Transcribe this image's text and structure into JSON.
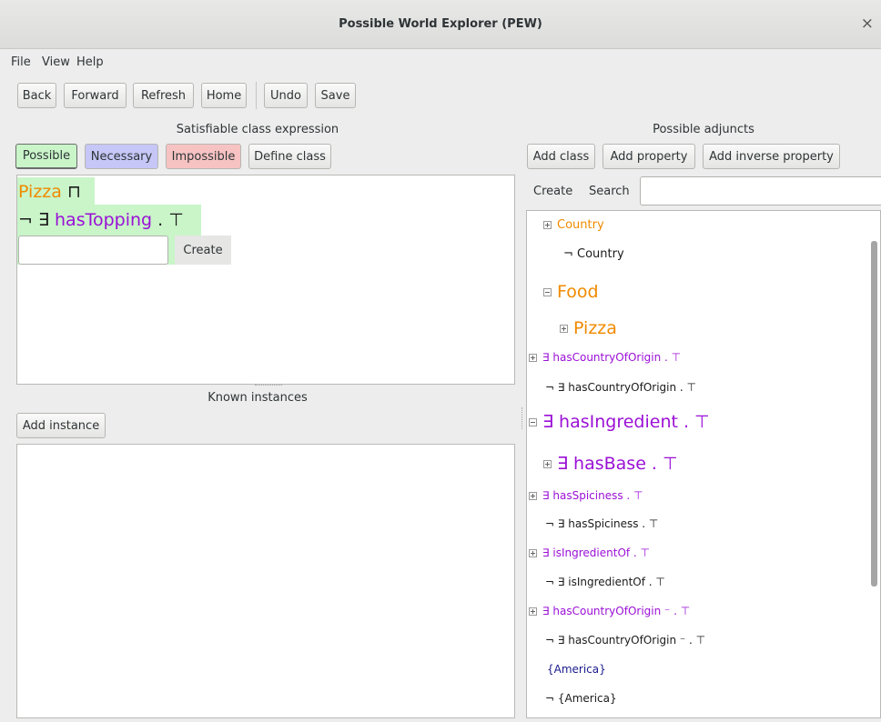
{
  "window": {
    "title": "Possible World Explorer (PEW)",
    "close_glyph": "×"
  },
  "menu": [
    "File",
    "View",
    "Help"
  ],
  "toolbar": {
    "back": "Back",
    "forward": "Forward",
    "refresh": "Refresh",
    "home": "Home",
    "undo": "Undo",
    "save": "Save"
  },
  "left": {
    "expr_title": "Satisfiable class expression",
    "modal_buttons": {
      "possible": "Possible",
      "necessary": "Necessary",
      "impossible": "Impossible",
      "define": "Define class"
    },
    "expression": {
      "line1_class": "Pizza",
      "line1_op": "⊓",
      "line2_neg": "¬ ∃",
      "line2_prop": "hasTopping",
      "line2_rest": ". ⊤"
    },
    "create_button": "Create",
    "instances_title": "Known instances",
    "add_instance": "Add instance"
  },
  "right": {
    "title": "Possible adjuncts",
    "buttons": {
      "add_class": "Add class",
      "add_property": "Add property",
      "add_inverse_property": "Add inverse property"
    },
    "create_label": "Create",
    "search_label": "Search",
    "tree": [
      {
        "text": "Country",
        "color": "orange",
        "expander": "plus"
      },
      {
        "text": "¬ Country",
        "color": "black",
        "expander": "none"
      },
      {
        "text": "Food",
        "color": "orange",
        "expander": "minus"
      },
      {
        "text": "Pizza",
        "color": "orange",
        "expander": "plus"
      },
      {
        "text": "∃ hasCountryOfOrigin . ⊤",
        "color": "purple",
        "expander": "plus"
      },
      {
        "text": "¬ ∃ hasCountryOfOrigin . ⊤",
        "color": "black",
        "expander": "none"
      },
      {
        "text": "∃ hasIngredient . ⊤",
        "color": "purple",
        "expander": "minus"
      },
      {
        "text": "∃ hasBase . ⊤",
        "color": "purple",
        "expander": "plus"
      },
      {
        "text": "∃ hasSpiciness . ⊤",
        "color": "purple",
        "expander": "plus"
      },
      {
        "text": "¬ ∃ hasSpiciness . ⊤",
        "color": "black",
        "expander": "none"
      },
      {
        "text": "∃ isIngredientOf . ⊤",
        "color": "purple",
        "expander": "plus"
      },
      {
        "text": "¬ ∃ isIngredientOf . ⊤",
        "color": "black",
        "expander": "none"
      },
      {
        "text": "∃ hasCountryOfOrigin ⁻ . ⊤",
        "color": "purple",
        "expander": "plus"
      },
      {
        "text": "¬ ∃ hasCountryOfOrigin ⁻ . ⊤",
        "color": "black",
        "expander": "none"
      },
      {
        "text": "{America}",
        "color": "navy",
        "expander": "none"
      },
      {
        "text": "¬ {America}",
        "color": "black",
        "expander": "none"
      }
    ]
  },
  "colors": {
    "possible_bg": "#c9f5c9",
    "necessary_bg": "#c6c6f7",
    "impossible_bg": "#f7c2c2",
    "class": "#f08a00",
    "property": "#9b10d6",
    "individual": "#1a1a8c",
    "expression_highlight": "#c9f5c9"
  }
}
